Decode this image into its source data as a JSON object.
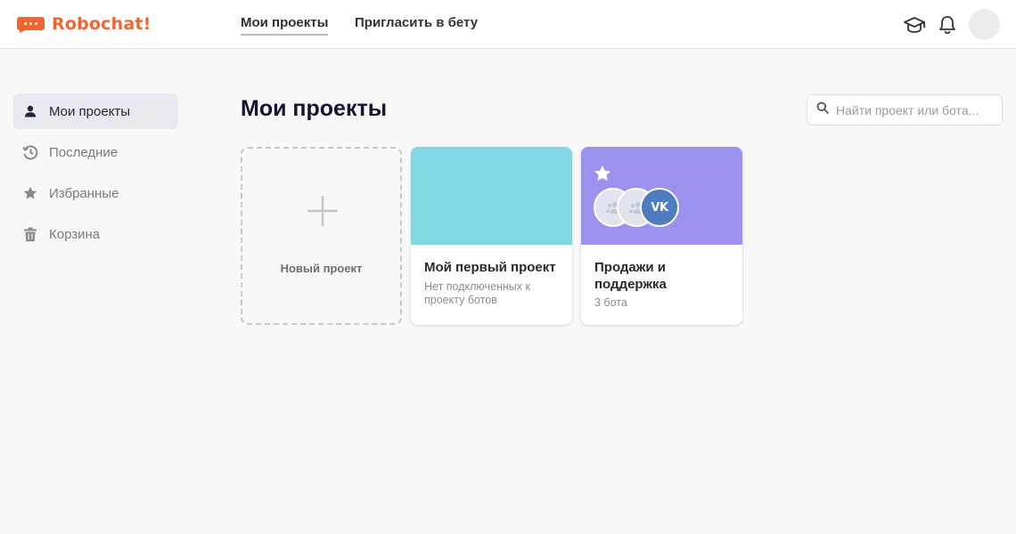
{
  "app": {
    "name": "Robochat!",
    "brand_color": "#f06432"
  },
  "header": {
    "nav": [
      {
        "label": "Мои проекты",
        "active": true
      },
      {
        "label": "Пригласить в бету",
        "active": false
      }
    ],
    "icons": [
      "graduation-cap-icon",
      "bell-icon"
    ]
  },
  "sidebar": {
    "items": [
      {
        "label": "Мои проекты",
        "icon": "user-icon",
        "active": true
      },
      {
        "label": "Последние",
        "icon": "history-icon",
        "active": false
      },
      {
        "label": "Избранные",
        "icon": "star-icon",
        "active": false
      },
      {
        "label": "Корзина",
        "icon": "trash-icon",
        "active": false
      }
    ]
  },
  "main": {
    "title": "Мои проекты",
    "search": {
      "placeholder": "Найти проект или бота...",
      "value": ""
    },
    "new_project_label": "Новый проект",
    "projects": [
      {
        "title": "Мой первый проект",
        "subtitle": "Нет подключенных к проекту ботов",
        "cover_color": "#7fd8e2",
        "favorite": false
      },
      {
        "title": "Продажи и поддержка",
        "subtitle": "3 бота",
        "cover_color": "#9b92ee",
        "favorite": true,
        "bots": [
          "bot-avatar-icon",
          "bot-avatar-icon",
          "vk-icon"
        ],
        "vk_label": "VK"
      }
    ]
  }
}
